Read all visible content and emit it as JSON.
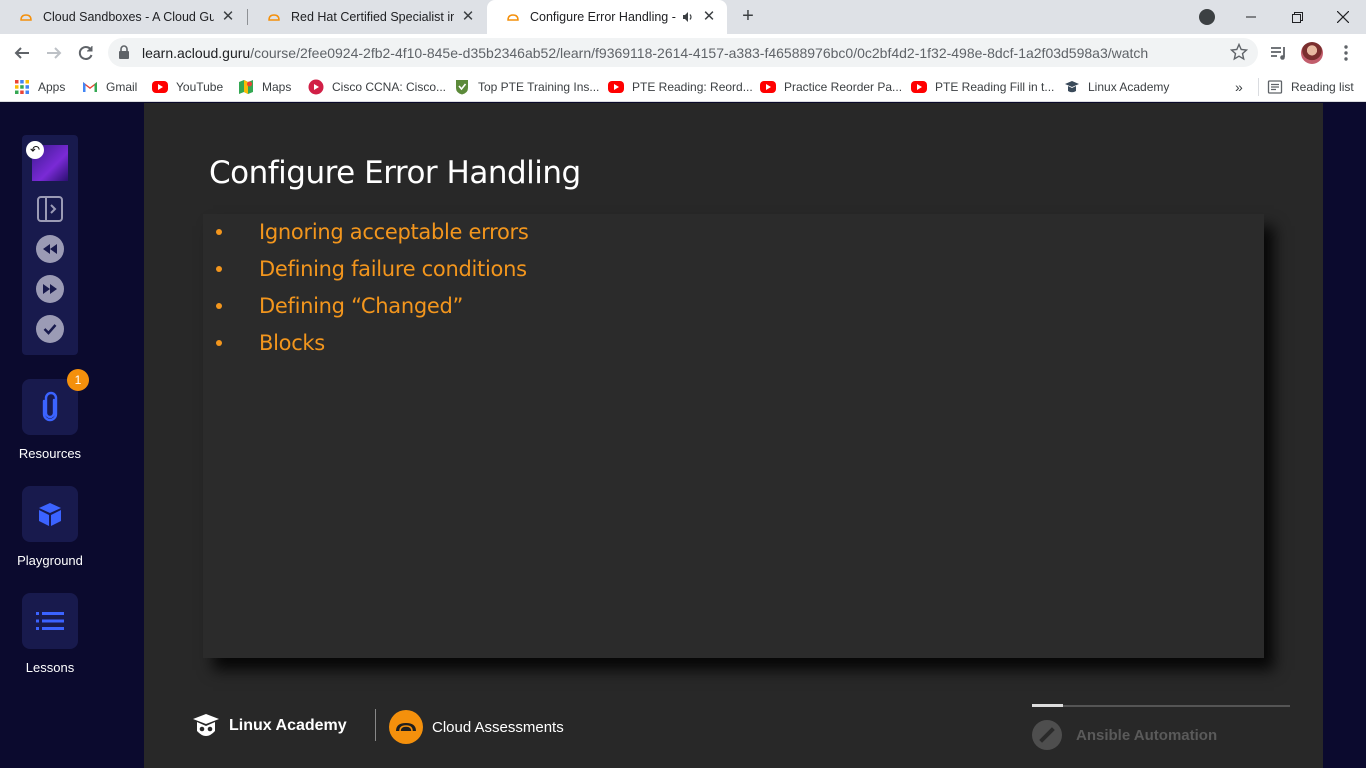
{
  "tabs": [
    {
      "title": "Cloud Sandboxes - A Cloud Guru",
      "close": "✕"
    },
    {
      "title": "Red Hat Certified Specialist in Ansible",
      "close": "✕"
    },
    {
      "title": "Configure Error Handling - A Cloud Guru",
      "close": "✕",
      "active": true
    }
  ],
  "window": {
    "new_tab": "+",
    "minimize": "—",
    "maximize": "❐",
    "close": "✕"
  },
  "address_bar": {
    "host": "learn.acloud.guru",
    "path": "/course/2fee0924-2fb2-4f10-845e-d35b2346ab52/learn/f9369118-2614-4157-a383-f46588976bc0/0c2bf4d2-1f32-498e-8dcf-1a2f03d598a3/watch"
  },
  "bookmarks": [
    {
      "label": "Apps",
      "icon": "apps-grid-icon"
    },
    {
      "label": "Gmail",
      "icon": "gmail-icon"
    },
    {
      "label": "YouTube",
      "icon": "youtube-icon"
    },
    {
      "label": "Maps",
      "icon": "maps-icon"
    },
    {
      "label": "Cisco CCNA: Cisco...",
      "icon": "cisco-icon"
    },
    {
      "label": "Top PTE Training Ins...",
      "icon": "pte-icon"
    },
    {
      "label": "PTE Reading: Reord...",
      "icon": "youtube-icon"
    },
    {
      "label": "Practice Reorder Pa...",
      "icon": "youtube-icon"
    },
    {
      "label": "PTE Reading Fill in t...",
      "icon": "youtube-icon"
    },
    {
      "label": "Linux Academy",
      "icon": "linux-academy-icon"
    }
  ],
  "bookmarks_overflow": "»",
  "reading_list": "Reading list",
  "sidebar": {
    "resources_label": "Resources",
    "resources_badge": "1",
    "playground_label": "Playground",
    "lessons_label": "Lessons"
  },
  "slide": {
    "title": "Configure Error Handling",
    "bullets": [
      "Ignoring acceptable errors",
      "Defining failure conditions",
      "Defining “Changed”",
      "Blocks"
    ],
    "footer_brand_1": "Linux Academy",
    "footer_brand_2": "Cloud Assessments",
    "section": "Ansible Automation",
    "section_progress": 0.12
  },
  "colors": {
    "accent_orange": "#f3961d",
    "sidebar_bg": "#0b0a2e",
    "panel_bg": "#181a4d",
    "slide_bg": "#282828"
  }
}
